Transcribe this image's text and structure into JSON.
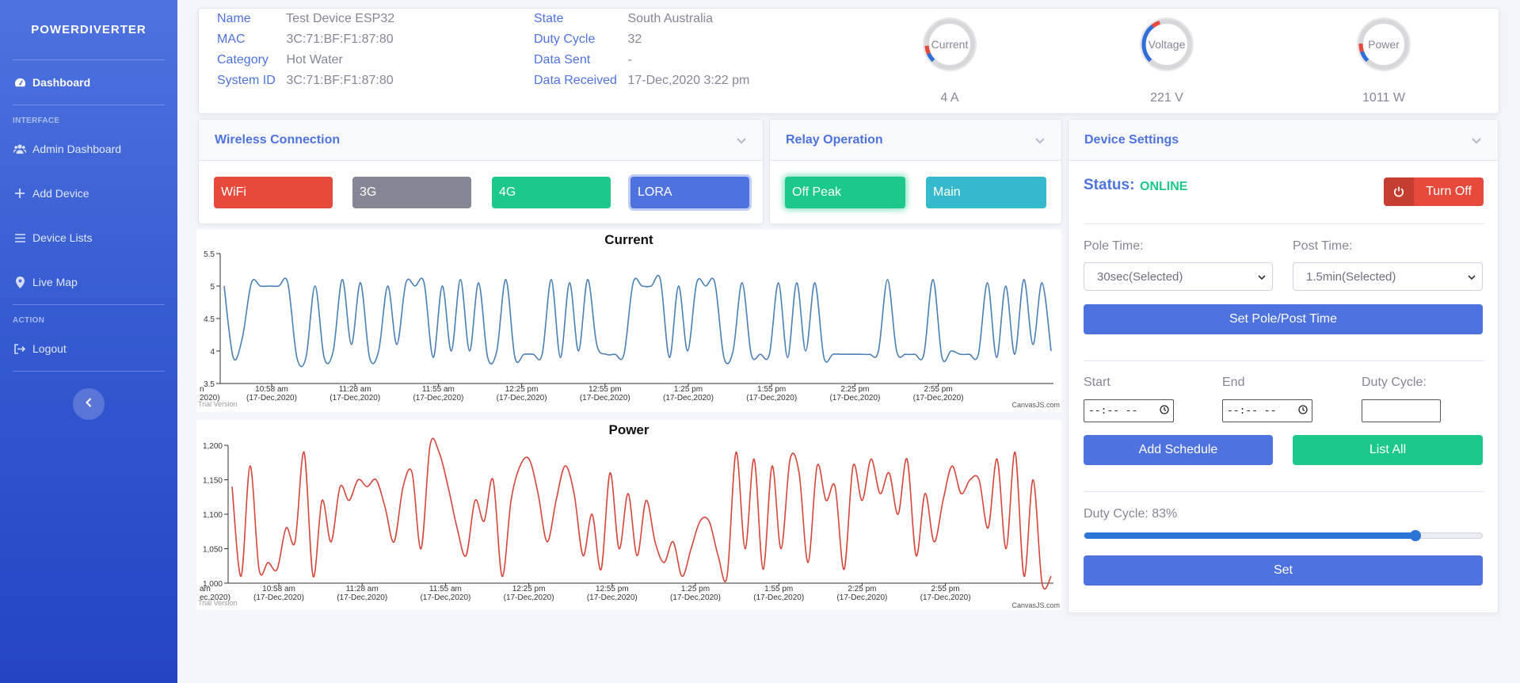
{
  "sidebar": {
    "brand": "POWERDIVERTER",
    "dashboard": "Dashboard",
    "heading_interface": "INTERFACE",
    "admin_dashboard": "Admin Dashboard",
    "add_device": "Add Device",
    "device_lists": "Device Lists",
    "live_map": "Live Map",
    "heading_action": "ACTION",
    "logout": "Logout"
  },
  "device": {
    "name_label": "Name",
    "name": "Test Device ESP32",
    "mac_label": "MAC",
    "mac": "3C:71:BF:F1:87:80",
    "category_label": "Category",
    "category": "Hot Water",
    "system_id_label": "System ID",
    "system_id": "3C:71:BF:F1:87:80",
    "state_label": "State",
    "state": "South Australia",
    "duty_cycle_label": "Duty Cycle",
    "duty_cycle": "32",
    "data_sent_label": "Data Sent",
    "data_sent": "-",
    "data_received_label": "Data Received",
    "data_received": "17-Dec,2020 3:22 pm"
  },
  "gauges": [
    {
      "label": "Current",
      "value": "4 A",
      "fraction": 0.08,
      "color": "#e74a3b"
    },
    {
      "label": "Voltage",
      "value": "221 V",
      "fraction": 0.36,
      "color": "#e74a3b"
    },
    {
      "label": "Power",
      "value": "1011 W",
      "fraction": 0.1,
      "color": "#e74a3b"
    }
  ],
  "wireless": {
    "title": "Wireless Connection",
    "wifi": "WiFi",
    "g3": "3G",
    "g4": "4G",
    "lora": "LORA"
  },
  "relay": {
    "title": "Relay Operation",
    "off_peak": "Off Peak",
    "main": "Main"
  },
  "settings": {
    "title": "Device Settings",
    "status_label": "Status:",
    "status_value": "ONLINE",
    "turn_off": "Turn Off",
    "pole_time_label": "Pole Time:",
    "pole_time_value": "30sec(Selected)",
    "post_time_label": "Post Time:",
    "post_time_value": "1.5min(Selected)",
    "set_pole_post": "Set Pole/Post Time",
    "start_label": "Start",
    "end_label": "End",
    "duty_cycle_label": "Duty Cycle:",
    "time_placeholder": "--:-- --",
    "add_schedule": "Add Schedule",
    "list_all": "List All",
    "duty_cycle_display": "Duty Cycle: 83%",
    "duty_cycle_value": 83,
    "set": "Set"
  },
  "colors": {
    "primary": "#4e73df",
    "danger": "#e74a3b",
    "success": "#1cc88a",
    "secondary": "#858796",
    "info": "#36b9cc",
    "current_line": "#4a7fb5",
    "power_line": "#d4463a"
  },
  "chart_credit": "CanvasJS.com",
  "chart_trial": "Trial Version",
  "chart_data": [
    {
      "type": "line",
      "title": "Current",
      "ylim": [
        3.5,
        5.5
      ],
      "yticks": [
        "3.5",
        "4",
        "4.5",
        "5",
        "5.5"
      ],
      "xticks": [
        [
          "10:58 am",
          "(17-Dec,2020)"
        ],
        [
          "11:28 am",
          "(17-Dec,2020)"
        ],
        [
          "11:55 am",
          "(17-Dec,2020)"
        ],
        [
          "12:25 pm",
          "(17-Dec,2020)"
        ],
        [
          "12:55 pm",
          "(17-Dec,2020)"
        ],
        [
          "1:25 pm",
          "(17-Dec,2020)"
        ],
        [
          "1:55 pm",
          "(17-Dec,2020)"
        ],
        [
          "2:25 pm",
          "(17-Dec,2020)"
        ],
        [
          "2:55 pm",
          "(17-Dec,2020)"
        ]
      ],
      "first_tick_fragment": [
        "n",
        "2020)"
      ],
      "values": [
        5,
        3.9,
        4.2,
        5.05,
        5,
        5,
        5,
        5.05,
        3.9,
        3.9,
        5,
        3.9,
        4,
        5.1,
        4.1,
        5.05,
        3.9,
        4,
        5,
        4.1,
        5.05,
        5,
        5.05,
        3.9,
        5,
        4,
        5.1,
        4,
        5.05,
        3.9,
        4,
        5.1,
        3.9,
        3.95,
        3.95,
        3.95,
        5.1,
        3.9,
        5.05,
        4,
        5.1,
        4.1,
        3.95,
        3.95,
        3.95,
        5.05,
        5,
        5,
        5.1,
        3.9,
        5,
        4,
        5.05,
        5,
        5.05,
        3.9,
        4,
        5.05,
        3.95,
        3.95,
        3.95,
        5.05,
        3.9,
        5.05,
        4,
        5.05,
        3.9,
        3.95,
        3.95,
        3.95,
        3.95,
        3.95,
        4,
        5.1,
        4,
        3.95,
        3.95,
        3.95,
        5.1,
        3.9,
        4,
        3.95,
        3.95,
        3.95,
        5.05,
        3.9,
        5,
        3.95,
        5.1,
        4.1,
        5.05,
        4
      ]
    },
    {
      "type": "line",
      "title": "Power",
      "ylim": [
        1000,
        1200
      ],
      "yticks": [
        "1,000",
        "1,050",
        "1,100",
        "1,150",
        "1,200"
      ],
      "xticks": [
        [
          "10:58 am",
          "(17-Dec,2020)"
        ],
        [
          "11:28 am",
          "(17-Dec,2020)"
        ],
        [
          "11:55 am",
          "(17-Dec,2020)"
        ],
        [
          "12:25 pm",
          "(17-Dec,2020)"
        ],
        [
          "12:55 pm",
          "(17-Dec,2020)"
        ],
        [
          "1:25 pm",
          "(17-Dec,2020)"
        ],
        [
          "1:55 pm",
          "(17-Dec,2020)"
        ],
        [
          "2:25 pm",
          "(17-Dec,2020)"
        ],
        [
          "2:55 pm",
          "(17-Dec,2020)"
        ]
      ],
      "first_tick_fragment": [
        "am",
        "ec,2020)"
      ],
      "values": [
        1140,
        1010,
        1170,
        1020,
        1030,
        1020,
        1080,
        1060,
        1190,
        1010,
        1120,
        1060,
        1140,
        1120,
        1150,
        1140,
        1150,
        1110,
        1060,
        1140,
        1160,
        1050,
        1200,
        1190,
        1140,
        1080,
        1040,
        1120,
        1090,
        1150,
        1010,
        1120,
        1170,
        1180,
        1130,
        1060,
        1120,
        1170,
        1130,
        1040,
        1100,
        1020,
        1160,
        1050,
        1130,
        1040,
        1120,
        1060,
        1030,
        1060,
        1010,
        1050,
        1090,
        1090,
        1040,
        1010,
        1190,
        1050,
        1180,
        1020,
        1170,
        1050,
        1180,
        1160,
        1030,
        1170,
        1120,
        1140,
        1020,
        1170,
        1120,
        1180,
        1130,
        1160,
        1100,
        1180,
        1040,
        1130,
        1060,
        1120,
        1170,
        1130,
        1150,
        1150,
        1080,
        1180,
        1050,
        1190,
        1010,
        1150,
        1000,
        1010
      ]
    }
  ]
}
